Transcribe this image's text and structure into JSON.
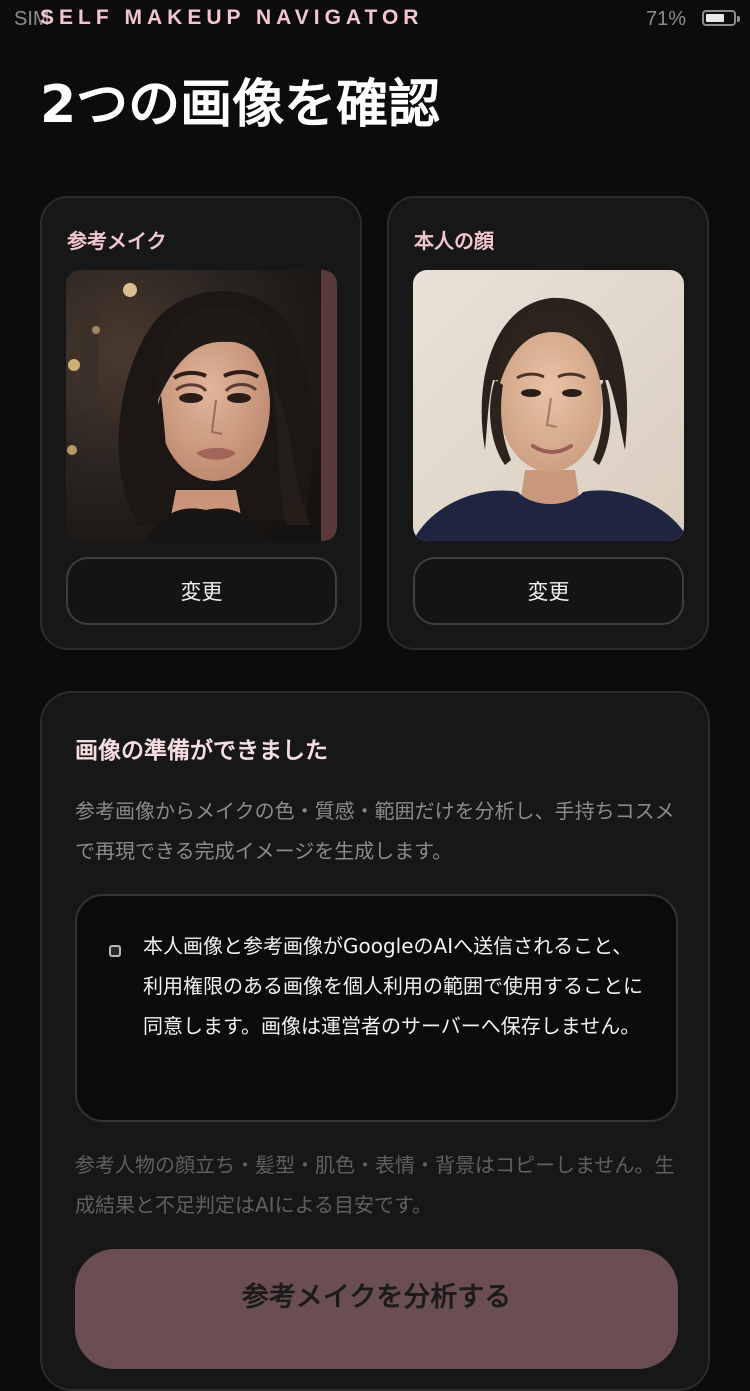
{
  "status_bar": {
    "carrier": "SIM",
    "app_brand": "SELF MAKEUP NAVIGATOR",
    "battery_percent": "71%",
    "battery_level": 0.71
  },
  "page_title": "2つの画像を確認",
  "reference_card": {
    "label": "参考メイク",
    "change_label": "変更"
  },
  "self_card": {
    "label": "本人の顔",
    "change_label": "変更"
  },
  "info_panel": {
    "title": "画像の準備ができました",
    "description": "参考画像からメイクの色・質感・範囲だけを分析し、手持ちコスメで再現できる完成イメージを生成します。",
    "consent_text": "本人画像と参考画像がGoogleのAIへ送信されること、利用権限のある画像を個人利用の範囲で使用することに同意します。画像は運営者のサーバーへ保存しません。",
    "disclaimer": "参考人物の顔立ち・髪型・肌色・表情・背景はコピーしません。生成結果と不足判定はAIによる目安です。",
    "analyze_button": "参考メイクを分析する"
  },
  "colors": {
    "background": "#0c0c0c",
    "card": "#171717",
    "accent_pink": "#f2c6cf",
    "button_rose": "#6b4e52"
  }
}
